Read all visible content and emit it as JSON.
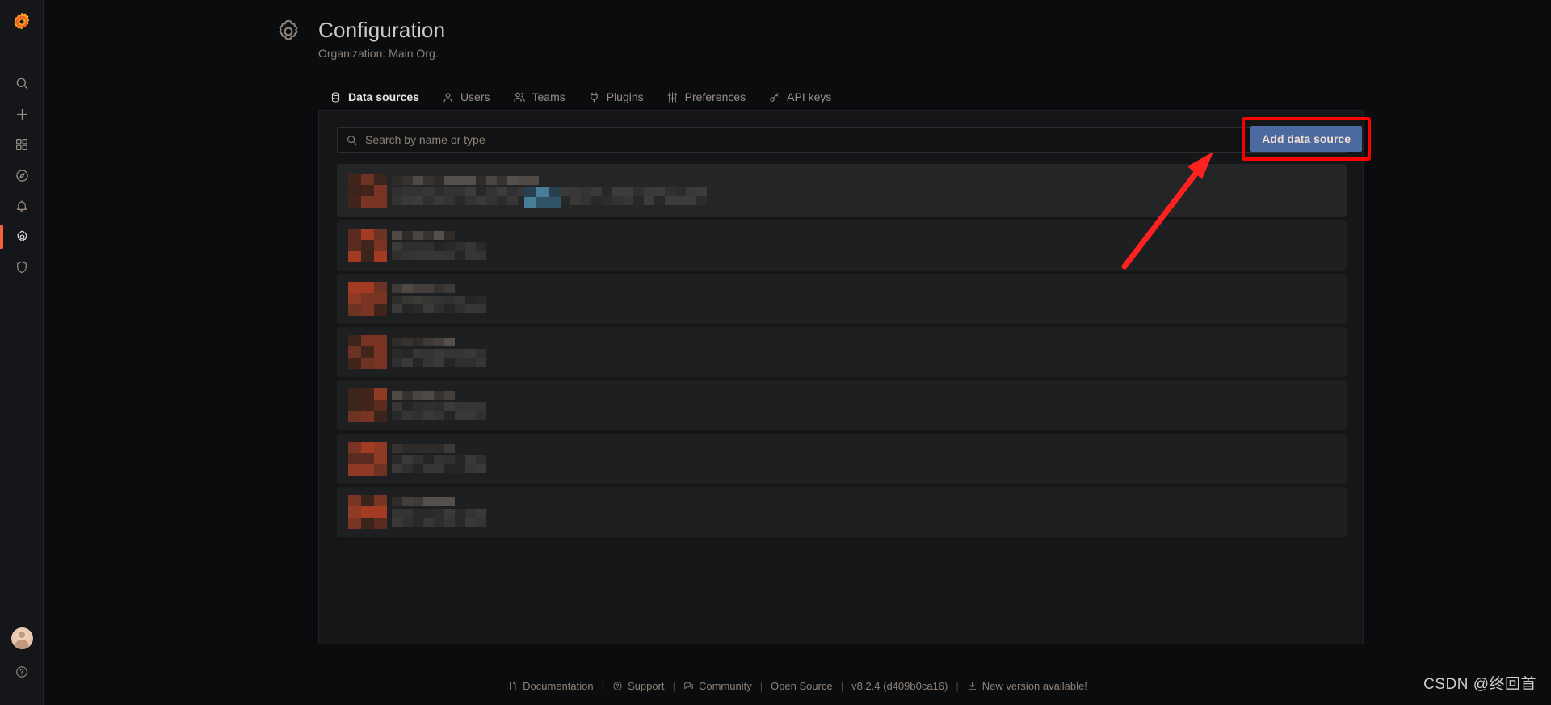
{
  "sidebar": {
    "logo": "grafana-logo",
    "items": [
      {
        "name": "search",
        "icon": "search-icon",
        "active": false
      },
      {
        "name": "create",
        "icon": "plus-icon",
        "active": false
      },
      {
        "name": "dashboards",
        "icon": "grid-icon",
        "active": false
      },
      {
        "name": "explore",
        "icon": "compass-icon",
        "active": false
      },
      {
        "name": "alerting",
        "icon": "bell-icon",
        "active": false
      },
      {
        "name": "configuration",
        "icon": "gear-icon",
        "active": true
      },
      {
        "name": "server-admin",
        "icon": "shield-icon",
        "active": false
      }
    ],
    "bottom": [
      {
        "name": "user-avatar",
        "icon": "avatar"
      },
      {
        "name": "help",
        "icon": "question-circle-icon"
      }
    ],
    "active_indicator_color": "#f55f3e"
  },
  "header": {
    "icon": "gear-icon",
    "title": "Configuration",
    "subtitle": "Organization: Main Org."
  },
  "tabs": [
    {
      "label": "Data sources",
      "icon": "database-icon",
      "active": true
    },
    {
      "label": "Users",
      "icon": "user-icon",
      "active": false
    },
    {
      "label": "Teams",
      "icon": "users-icon",
      "active": false
    },
    {
      "label": "Plugins",
      "icon": "plug-icon",
      "active": false
    },
    {
      "label": "Preferences",
      "icon": "sliders-icon",
      "active": false
    },
    {
      "label": "API keys",
      "icon": "key-icon",
      "active": false
    }
  ],
  "search": {
    "placeholder": "Search by name or type",
    "value": "",
    "icon": "search-icon"
  },
  "actions": {
    "add_data_source_label": "Add data source",
    "add_data_source_color": "#4b6aa0",
    "highlight_box_color": "#ff0000",
    "arrow_color": "#ff2020"
  },
  "data_source_rows": [
    {
      "name": "data-source-row-1",
      "redacted": true,
      "has_badge": true,
      "highlighted": true
    },
    {
      "name": "data-source-row-2",
      "redacted": true,
      "has_badge": false,
      "highlighted": false
    },
    {
      "name": "data-source-row-3",
      "redacted": true,
      "has_badge": false,
      "highlighted": false
    },
    {
      "name": "data-source-row-4",
      "redacted": true,
      "has_badge": false,
      "highlighted": false
    },
    {
      "name": "data-source-row-5",
      "redacted": true,
      "has_badge": false,
      "highlighted": false
    },
    {
      "name": "data-source-row-6",
      "redacted": true,
      "has_badge": false,
      "highlighted": false
    },
    {
      "name": "data-source-row-7",
      "redacted": true,
      "has_badge": false,
      "highlighted": false
    }
  ],
  "footer": {
    "items": [
      {
        "label": "Documentation",
        "icon": "document-icon"
      },
      {
        "label": "Support",
        "icon": "question-circle-icon"
      },
      {
        "label": "Community",
        "icon": "comments-icon"
      },
      {
        "label": "Open Source",
        "icon": ""
      },
      {
        "label": "v8.2.4 (d409b0ca16)",
        "icon": ""
      },
      {
        "label": "New version available!",
        "icon": "download-icon"
      }
    ],
    "separator": "|"
  },
  "watermark": {
    "text": "CSDN @终回首"
  }
}
